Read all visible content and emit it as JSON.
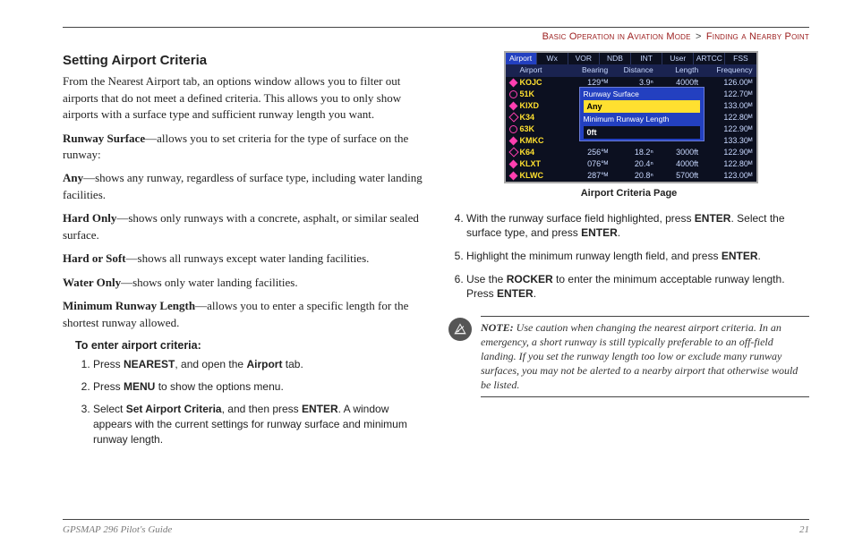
{
  "breadcrumb": {
    "section": "Basic Operation in Aviation Mode",
    "sep": ">",
    "subsection": "Finding a Nearby Point"
  },
  "left": {
    "heading": "Setting Airport Criteria",
    "intro": "From the Nearest Airport tab, an options window allows you to filter out airports that do not meet a defined criteria. This allows you to only show airports with a surface type and sufficient runway length you want.",
    "runwaySurface": {
      "term": "Runway Surface",
      "desc": "—allows you to set criteria for the type of surface on the runway:"
    },
    "options": {
      "any": {
        "term": "Any",
        "desc": "—shows any runway, regardless of surface type, including water landing facilities."
      },
      "hardOnly": {
        "term": "Hard Only",
        "desc": "—shows only runways with a concrete, asphalt, or similar sealed surface."
      },
      "hardSoft": {
        "term": "Hard or Soft",
        "desc": "—shows all runways except water landing facilities."
      },
      "waterOnly": {
        "term": "Water Only",
        "desc": "—shows only water landing facilities."
      }
    },
    "minRunway": {
      "term": "Minimum Runway Length",
      "desc": "—allows you to enter a specific length for the shortest runway allowed."
    },
    "procHeading": "To enter airport criteria:",
    "steps": {
      "s1a": "Press ",
      "s1b": "NEAREST",
      "s1c": ", and open the ",
      "s1d": "Airport",
      "s1e": " tab.",
      "s2a": "Press ",
      "s2b": "MENU",
      "s2c": " to show the options menu.",
      "s3a": "Select ",
      "s3b": "Set Airport Criteria",
      "s3c": ", and then press ",
      "s3d": "ENTER",
      "s3e": ". A window appears with the current settings for runway surface and minimum runway length."
    }
  },
  "device": {
    "tabs": [
      "Airport",
      "Wx",
      "VOR",
      "NDB",
      "INT",
      "User",
      "ARTCC",
      "FSS"
    ],
    "headers": {
      "airport": "Airport",
      "bearing": "Bearing",
      "distance": "Distance",
      "length": "Length",
      "freq": "Frequency"
    },
    "rows": [
      {
        "mark": "dfill",
        "id": "KOJC",
        "brg": "129°ᴹ",
        "dist": "3.9ⁿ",
        "len": "4000ft",
        "freq": "126.00ᴹ"
      },
      {
        "mark": "copen",
        "id": "51K",
        "brg": "",
        "dist": "",
        "len": "",
        "freq": "122.70ᴹ"
      },
      {
        "mark": "dfill",
        "id": "KIXD",
        "brg": "",
        "dist": "",
        "len": "",
        "freq": "133.00ᴹ"
      },
      {
        "mark": "dopen",
        "id": "K34",
        "brg": "",
        "dist": "",
        "len": "",
        "freq": "122.80ᴹ"
      },
      {
        "mark": "copen",
        "id": "63K",
        "brg": "",
        "dist": "",
        "len": "",
        "freq": "122.90ᴹ"
      },
      {
        "mark": "dfill",
        "id": "KMKC",
        "brg": "",
        "dist": "",
        "len": "",
        "freq": "133.30ᴹ"
      },
      {
        "mark": "dopen",
        "id": "K64",
        "brg": "256°ᴹ",
        "dist": "18.2ⁿ",
        "len": "3000ft",
        "freq": "122.90ᴹ"
      },
      {
        "mark": "dfill",
        "id": "KLXT",
        "brg": "076°ᴹ",
        "dist": "20.4ⁿ",
        "len": "4000ft",
        "freq": "122.80ᴹ"
      },
      {
        "mark": "dfill",
        "id": "KLWC",
        "brg": "287°ᴹ",
        "dist": "20.8ⁿ",
        "len": "5700ft",
        "freq": "123.00ᴹ"
      }
    ],
    "popup": {
      "l1": "Runway Surface",
      "v1": "Any",
      "l2": "Minimum Runway Length",
      "v2": "0ft"
    },
    "caption": "Airport Criteria Page"
  },
  "right": {
    "s4a": "With the runway surface field highlighted, press ",
    "s4b": "ENTER",
    "s4c": ". Select the surface type, and press ",
    "s4d": "ENTER",
    "s4e": ".",
    "s5a": "Highlight the minimum runway length field, and press ",
    "s5b": "ENTER",
    "s5c": ".",
    "s6a": "Use the ",
    "s6b": "ROCKER",
    "s6c": " to enter the minimum acceptable runway length. Press ",
    "s6d": "ENTER",
    "s6e": "."
  },
  "note": {
    "label": "NOTE:",
    "body": " Use caution when changing the nearest airport criteria. In an emergency, a short runway is still typically preferable to an off-field landing. If you set the runway length too low or exclude many runway surfaces, you may not be alerted to a nearby airport that otherwise would be listed."
  },
  "footer": {
    "guide": "GPSMAP 296 Pilot's Guide",
    "page": "21"
  }
}
